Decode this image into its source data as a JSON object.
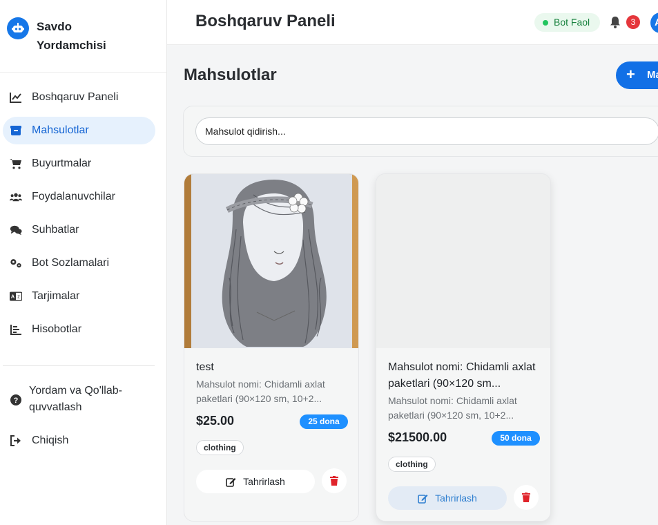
{
  "brand": {
    "name": "Savdo Yordamchisi",
    "logo_icon": "robot-icon",
    "accent": "#1677e8"
  },
  "sidebar": {
    "items": [
      {
        "label": "Boshqaruv Paneli",
        "icon": "chart-line-icon",
        "active": false
      },
      {
        "label": "Mahsulotlar",
        "icon": "box-icon",
        "active": true
      },
      {
        "label": "Buyurtmalar",
        "icon": "cart-icon",
        "active": false
      },
      {
        "label": "Foydalanuvchilar",
        "icon": "users-icon",
        "active": false
      },
      {
        "label": "Suhbatlar",
        "icon": "comments-icon",
        "active": false
      },
      {
        "label": "Bot Sozlamalari",
        "icon": "gears-icon",
        "active": false
      },
      {
        "label": "Tarjimalar",
        "icon": "language-icon",
        "active": false
      },
      {
        "label": "Hisobotlar",
        "icon": "report-icon",
        "active": false
      }
    ],
    "help_label": "Yordam va Qo'llab-quvvatlash",
    "logout_label": "Chiqish"
  },
  "header": {
    "title": "Boshqaruv Paneli",
    "status_label": "Bot Faol",
    "status_color": "#22c55e",
    "notification_count": "3",
    "avatar_letter": "A"
  },
  "main": {
    "title": "Mahsulotlar",
    "add_button_label": "Ma",
    "search_placeholder": "Mahsulot qidirish...",
    "products": [
      {
        "title": "test",
        "description": "Mahsulot nomi: Chidamli axlat paketlari (90×120 sm, 10+2...",
        "price": "$25.00",
        "stock": "25 dona",
        "category": "clothing",
        "edit_label": "Tahrirlash",
        "has_image": true
      },
      {
        "title": "Mahsulot nomi: Chidamli axlat paketlari (90×120 sm...",
        "description": "Mahsulot nomi: Chidamli axlat paketlari (90×120 sm, 10+2...",
        "price": "$21500.00",
        "stock": "50 dona",
        "category": "clothing",
        "edit_label": "Tahrirlash",
        "has_image": false
      }
    ]
  }
}
